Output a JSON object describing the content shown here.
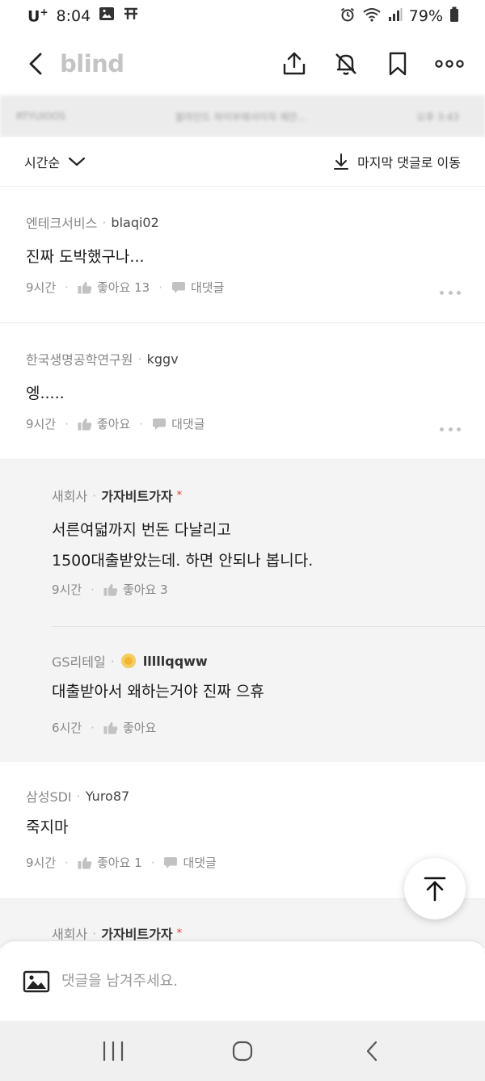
{
  "status_bar": {
    "carrier": "U",
    "carrier_suffix": "+",
    "time": "8:04",
    "battery": "79%"
  },
  "header": {
    "brand": "blind",
    "icons": [
      "back-arrow-icon",
      "share-icon",
      "notifications-off-icon",
      "bookmark-icon",
      "more-icon"
    ]
  },
  "blurred_strip": {
    "left": "RTYUIOOS",
    "center": "블라인드 하이부에서이직 제안...",
    "right": "오후 3:43"
  },
  "sort_bar": {
    "sort_label": "시간순",
    "jump_label": "마지막 댓글로 이동"
  },
  "comments": [
    {
      "company": "엔테크서비스",
      "nickname": "blaqi02",
      "text": "진짜 도박했구나...",
      "time": "9시간",
      "like_label": "좋아요 13",
      "reply_label": "대댓글"
    },
    {
      "company": "한국생명공학연구원",
      "nickname": "kggv",
      "text": "엥.....",
      "time": "9시간",
      "like_label": "좋아요",
      "reply_label": "대댓글"
    },
    {
      "company": "새회사",
      "nickname": "가자비트가자",
      "op_mark": "*",
      "text_line1": "서른여덟까지 번돈 다날리고",
      "text_line2": "1500대출받았는데. 하면 안되나 봅니다.",
      "time": "9시간",
      "like_label": "좋아요 3"
    },
    {
      "company": "GS리테일",
      "nickname": "lllllqqww",
      "text": "대출받아서 왜하는거야 진짜 으휴",
      "time": "6시간",
      "like_label": "좋아요"
    },
    {
      "company": "삼성SDI",
      "nickname": "Yuro87",
      "text": "죽지마",
      "time": "9시간",
      "like_label": "좋아요 1",
      "reply_label": "대댓글"
    },
    {
      "company": "새회사",
      "nickname": "가자비트가자",
      "op_mark": "*"
    }
  ],
  "compose": {
    "placeholder": "댓글을 남겨주세요."
  },
  "colors": {
    "accent_red": "#e53935",
    "reply_background": "#f4f4f4",
    "muted_text": "#888888"
  }
}
